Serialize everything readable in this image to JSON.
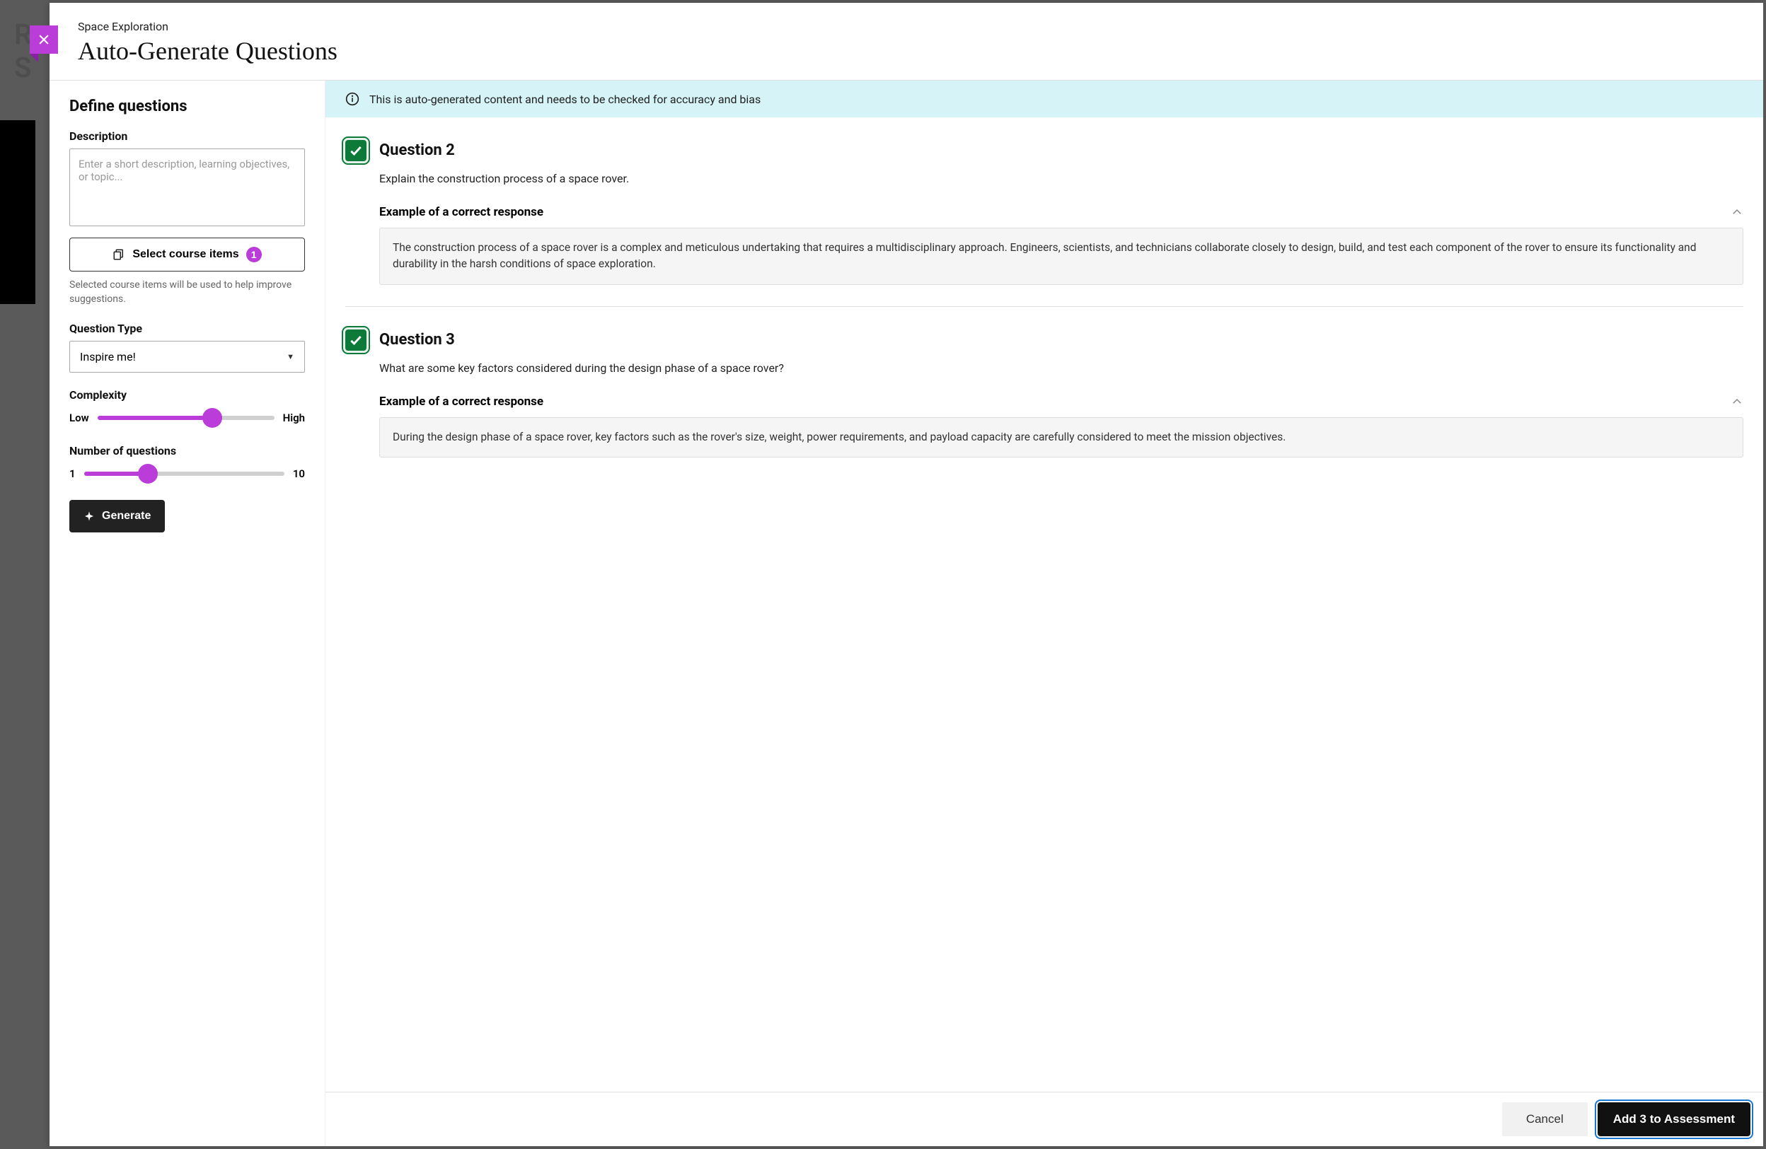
{
  "header": {
    "breadcrumb": "Space Exploration",
    "title": "Auto-Generate Questions"
  },
  "define": {
    "section_title": "Define questions",
    "description_label": "Description",
    "description_placeholder": "Enter a short description, learning objectives, or topic...",
    "select_items_label": "Select course items",
    "select_items_badge": "1",
    "select_items_help": "Selected course items will be used to help improve suggestions.",
    "question_type_label": "Question Type",
    "question_type_value": "Inspire me!",
    "complexity_label": "Complexity",
    "complexity_low": "Low",
    "complexity_high": "High",
    "complexity_fill_pct": "65%",
    "num_label": "Number of questions",
    "num_min": "1",
    "num_max": "10",
    "num_fill_pct": "32%",
    "generate_label": "Generate"
  },
  "banner": {
    "text": "This is auto-generated content and needs to be checked for accuracy and bias"
  },
  "questions": [
    {
      "title": "Question 2",
      "prompt": "Explain the construction process of a space rover.",
      "example_label": "Example of a correct response",
      "example_body": "The construction process of a space rover is a complex and meticulous undertaking that requires a multidisciplinary approach. Engineers, scientists, and technicians collaborate closely to design, build, and test each component of the rover to ensure its functionality and durability in the harsh conditions of space exploration."
    },
    {
      "title": "Question 3",
      "prompt": "What are some key factors considered during the design phase of a space rover?",
      "example_label": "Example of a correct response",
      "example_body": "During the design phase of a space rover, key factors such as the rover's size, weight, power requirements, and payload capacity are carefully considered to meet the mission objectives."
    }
  ],
  "footer": {
    "cancel": "Cancel",
    "add": "Add 3 to Assessment"
  }
}
